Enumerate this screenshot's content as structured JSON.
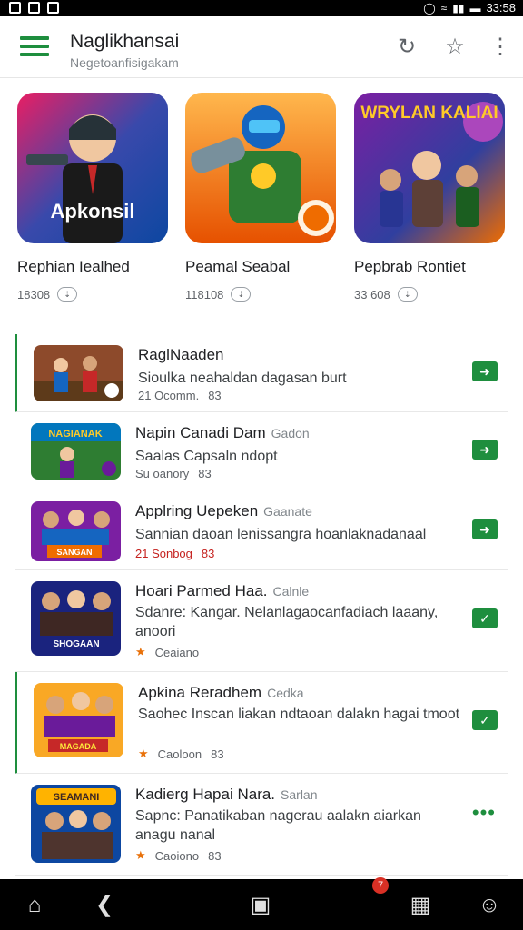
{
  "status_bar": {
    "time": "33:58"
  },
  "app_bar": {
    "title": "Naglikhansai",
    "subtitle": "Negetoanfisigakam",
    "icons": [
      "menu-icon",
      "refresh-icon",
      "star-icon",
      "more-vert-icon"
    ]
  },
  "featured": [
    {
      "title": "Rephian Iealhed",
      "image_text": "Apkonsil",
      "meta": "18308",
      "accent": "#1565c0"
    },
    {
      "title": "Peamal Seabal",
      "image_text": "",
      "meta": "118108",
      "accent": "#ef6c00"
    },
    {
      "title": "Pepbrab Rontiet",
      "image_text": "WRYLAN KALIAI",
      "meta": "33 608",
      "accent": "#6a1b9a"
    }
  ],
  "list": [
    {
      "name": "RaglNaaden",
      "tag": "",
      "desc": "Sioulka neahaldan dagasan burt",
      "meta": "21 Ocomm.",
      "meta2": "83",
      "action": "arrow",
      "image_text": ""
    },
    {
      "name": "Napin Canadi Dam",
      "tag": "Gadon",
      "desc": "Saalas Capsaln ndopt",
      "meta": "Su oanory",
      "meta2": "83",
      "action": "arrow",
      "image_text": "NAGIANAK"
    },
    {
      "name": "Applring Uepeken",
      "tag": "Gaanate",
      "desc": "Sannian daoan lenissangra hoanlaknadanaal",
      "meta": "21 Sonbog",
      "meta2": "83",
      "action": "arrow",
      "image_text": "SANGAN"
    },
    {
      "name": "Hoari Parmed Haa.",
      "tag": "Calnle",
      "desc": "Sdanre: Kangar. Nelanlagaocanfadiach laaany, anoori",
      "meta": "Ceaiano",
      "meta2": "",
      "action": "check",
      "image_text": "SHOGAAN"
    },
    {
      "name": "Apkina Reradhem",
      "tag": "Cedka",
      "desc": "Saohec Inscan liakan ndtaoan dalakn hagai tmoot",
      "meta": "Caoloon",
      "meta2": "83",
      "action": "check",
      "image_text": "MAGADA"
    },
    {
      "name": "Kadierg Hapai Nara.",
      "tag": "Sarlan",
      "desc": "Sapnc: Panatikaban nagerau aalakn aiarkan anagu nanal",
      "meta": "Caoiono",
      "meta2": "83",
      "action": "more",
      "image_text": "SEAMANI"
    }
  ],
  "nav": {
    "icons": [
      "home-icon",
      "back-icon",
      "store-icon",
      "gamepad-icon",
      "profile-icon"
    ],
    "badge": "7"
  },
  "colors": {
    "accent": "#1e8e3e",
    "star": "#e8710a"
  }
}
